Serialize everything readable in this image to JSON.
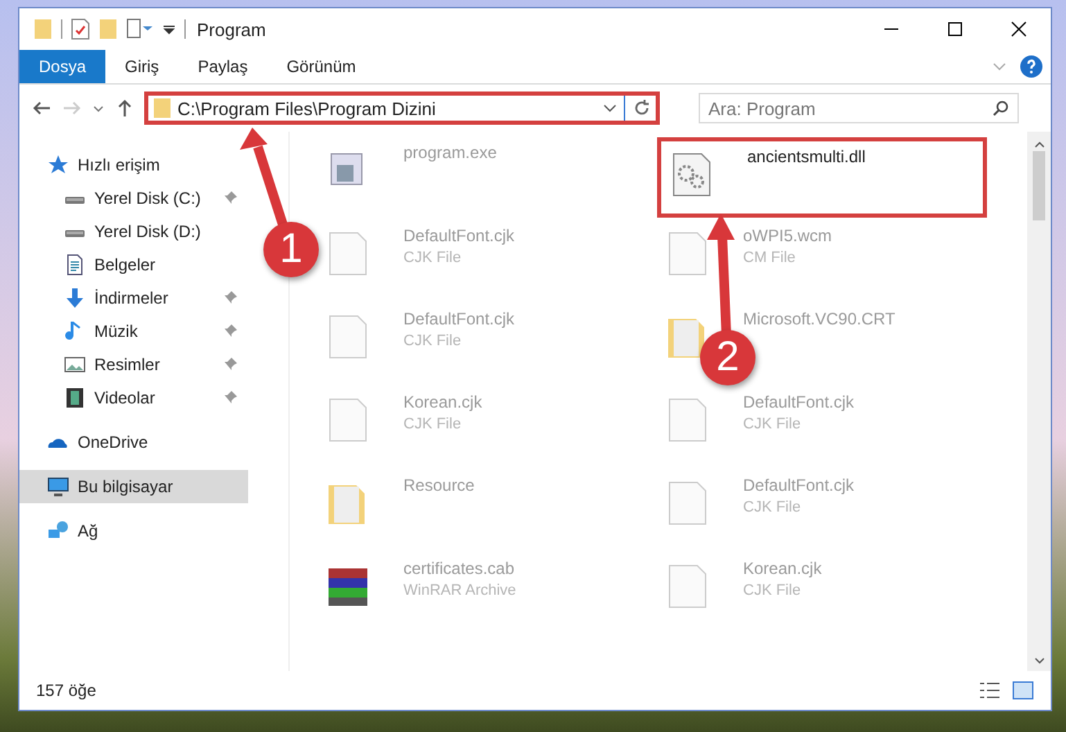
{
  "window": {
    "title": "Program"
  },
  "ribbon_tabs": [
    {
      "label": "Dosya",
      "selected": true
    },
    {
      "label": "Giriş",
      "selected": false
    },
    {
      "label": "Paylaş",
      "selected": false
    },
    {
      "label": "Görünüm",
      "selected": false
    }
  ],
  "address": {
    "value": "C:\\Program Files\\Program Dizini",
    "highlighted": true
  },
  "search": {
    "placeholder": "Ara: Program"
  },
  "sidebar": {
    "items": [
      {
        "label": "Hızlı erişim",
        "kind": "star",
        "selected": false,
        "children": [
          {
            "label": "Yerel Disk (C:)",
            "kind": "drive",
            "pinned": true,
            "selected": false
          },
          {
            "label": "Yerel Disk (D:)",
            "kind": "drive",
            "pinned": false,
            "selected": false
          },
          {
            "label": "Belgeler",
            "kind": "docs",
            "pinned": false,
            "selected": false
          },
          {
            "label": "İndirmeler",
            "kind": "download",
            "pinned": true,
            "selected": false
          },
          {
            "label": "Müzik",
            "kind": "music",
            "pinned": true,
            "selected": false
          },
          {
            "label": "Resimler",
            "kind": "pictures",
            "pinned": true,
            "selected": false
          },
          {
            "label": "Videolar",
            "kind": "videos",
            "pinned": true,
            "selected": false
          }
        ]
      },
      {
        "label": "OneDrive",
        "kind": "cloud",
        "selected": false
      },
      {
        "label": "Bu bilgisayar",
        "kind": "computer",
        "selected": true
      },
      {
        "label": "Ağ",
        "kind": "network",
        "selected": false
      }
    ]
  },
  "files": [
    {
      "name": "program.exe",
      "kind": "exe",
      "blurred": true,
      "highlighted": false
    },
    {
      "name": "ancientsmulti.dll",
      "kind": "dll",
      "blurred": false,
      "highlighted": true
    },
    {
      "name": "DefaultFont.cjk",
      "type": "CJK File",
      "kind": "doc",
      "blurred": true,
      "highlighted": false
    },
    {
      "name": "oWPI5.wcm",
      "type": "CM File",
      "kind": "doc",
      "blurred": true,
      "highlighted": false
    },
    {
      "name": "DefaultFont.cjk",
      "type": "CJK File",
      "kind": "doc",
      "blurred": true,
      "highlighted": false
    },
    {
      "name": "Microsoft.VC90.CRT",
      "kind": "folder",
      "blurred": true,
      "highlighted": false
    },
    {
      "name": "Korean.cjk",
      "type": "CJK File",
      "kind": "doc",
      "blurred": true,
      "highlighted": false
    },
    {
      "name": "DefaultFont.cjk",
      "type": "CJK File",
      "kind": "doc",
      "blurred": true,
      "highlighted": false
    },
    {
      "name": "Resource",
      "kind": "folder",
      "blurred": true,
      "highlighted": false
    },
    {
      "name": "DefaultFont.cjk",
      "type": "CJK File",
      "kind": "doc",
      "blurred": true,
      "highlighted": false
    },
    {
      "name": "certificates.cab",
      "type": "WinRAR Archive",
      "kind": "archive",
      "blurred": true,
      "highlighted": false
    },
    {
      "name": "Korean.cjk",
      "type": "CJK File",
      "kind": "doc",
      "blurred": true,
      "highlighted": false
    }
  ],
  "status_bar": {
    "count": "157 öğe"
  },
  "annotations": [
    {
      "number": "1"
    },
    {
      "number": "2"
    }
  ]
}
